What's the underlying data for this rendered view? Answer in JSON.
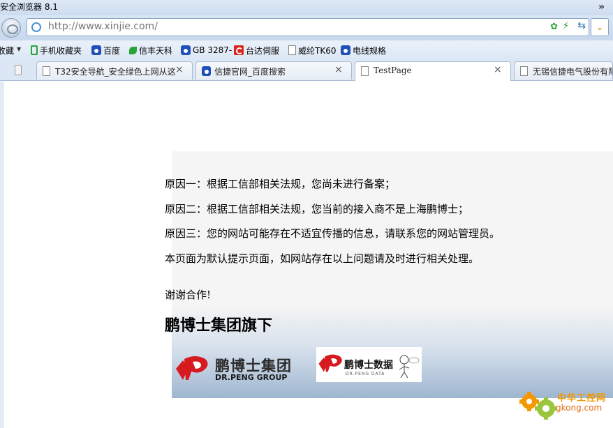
{
  "window": {
    "title": "安全浏览器 8.1",
    "overflow_label": "»"
  },
  "address_bar": {
    "url": "http://www.xinjie.com/"
  },
  "favorites": {
    "menu_label": "收藏",
    "items": [
      {
        "label": "手机收藏夹",
        "icon": "phone-icon"
      },
      {
        "label": "百度",
        "icon": "baidu-paw-icon"
      },
      {
        "label": "信丰天科",
        "icon": "leaf-icon"
      },
      {
        "label": "GB 3287-",
        "icon": "baidu-paw-icon"
      },
      {
        "label": "台达伺服",
        "icon": "c-logo-icon"
      },
      {
        "label": "威纶TK60",
        "icon": "document-icon"
      },
      {
        "label": "电线规格",
        "icon": "baidu-paw-icon"
      }
    ]
  },
  "tabs": [
    {
      "label": "T32安全导航_安全绿色上网从这",
      "icon": "document-icon",
      "close": "×",
      "active": false
    },
    {
      "label": "信捷官网_百度搜索",
      "icon": "baidu-paw-icon",
      "close": "×",
      "active": false
    },
    {
      "label": "TestPage",
      "icon": "document-icon",
      "close": "×",
      "active": true
    },
    {
      "label": "无锡信捷电气股份有限",
      "icon": "document-icon",
      "close": "",
      "active": false
    }
  ],
  "content": {
    "reason1": "原因一：根据工信部相关法规，您尚未进行备案；",
    "reason2": "原因二：根据工信部相关法规，您当前的接入商不是上海鹏博士；",
    "reason3": "原因三：您的网站可能存在不适宜传播的信息，请联系您的网站管理员。",
    "note": "本页面为默认提示页面，如网站存在以上问题请及时进行相关处理。",
    "thanks": "谢谢合作!",
    "heading": "鹏博士集团旗下"
  },
  "logos": {
    "group": {
      "name": "鹏博士集团",
      "sub": "DR.PENG GROUP"
    },
    "data": {
      "name": "鹏博士数据",
      "sub": "DR.PENG DATA"
    }
  },
  "watermark": {
    "name": "中华工控网",
    "url": "gkong.com"
  },
  "colors": {
    "brand_red": "#d71920",
    "chrome_blue": "#cddcf0",
    "watermark_orange": "#f39800"
  }
}
